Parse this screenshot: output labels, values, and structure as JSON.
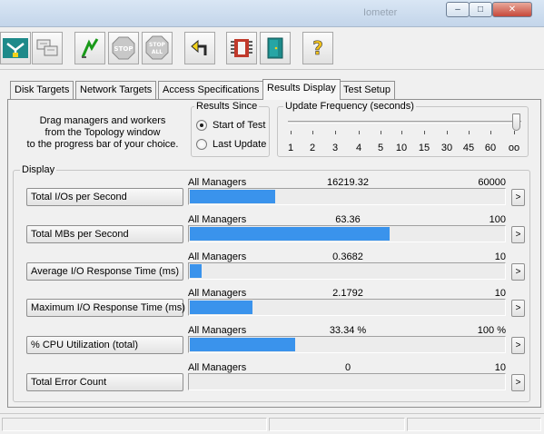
{
  "window": {
    "background_title": "Iometer"
  },
  "toolbar": {
    "buttons": [
      {
        "icon": "topology-icon"
      },
      {
        "icon": "disk-workers-icon"
      },
      {
        "icon": "start-flag-icon"
      },
      {
        "icon": "stop-icon",
        "text": "STOP"
      },
      {
        "icon": "stop-all-icon",
        "text": "STOP ALL"
      },
      {
        "icon": "reset-workers-icon"
      },
      {
        "icon": "open-config-icon"
      },
      {
        "icon": "exit-icon"
      },
      {
        "icon": "help-icon",
        "text": "?"
      }
    ]
  },
  "tabs": [
    {
      "label": "Disk Targets",
      "active": false
    },
    {
      "label": "Network Targets",
      "active": false
    },
    {
      "label": "Access Specifications",
      "active": false
    },
    {
      "label": "Results Display",
      "active": true
    },
    {
      "label": "Test Setup",
      "active": false
    }
  ],
  "drag_text": {
    "line1": "Drag managers and workers",
    "line2": "from the Topology window",
    "line3": "to the progress bar of your choice."
  },
  "results_since": {
    "label": "Results Since",
    "options": [
      {
        "label": "Start of Test",
        "checked": true
      },
      {
        "label": "Last Update",
        "checked": false
      }
    ]
  },
  "update_frequency": {
    "label": "Update Frequency (seconds)",
    "ticks": [
      "1",
      "2",
      "3",
      "4",
      "5",
      "10",
      "15",
      "30",
      "45",
      "60",
      "oo"
    ],
    "selected": "oo"
  },
  "display": {
    "label": "Display",
    "more_label": ">",
    "rows": [
      {
        "metric": "Total I/Os per Second",
        "manager": "All Managers",
        "value": "16219.32",
        "max": "60000",
        "fill": 0.27
      },
      {
        "metric": "Total MBs per Second",
        "manager": "All Managers",
        "value": "63.36",
        "max": "100",
        "fill": 0.634
      },
      {
        "metric": "Average I/O Response Time (ms)",
        "manager": "All Managers",
        "value": "0.3682",
        "max": "10",
        "fill": 0.037
      },
      {
        "metric": "Maximum I/O Response Time (ms)",
        "manager": "All Managers",
        "value": "2.1792",
        "max": "10",
        "fill": 0.2
      },
      {
        "metric": "% CPU Utilization (total)",
        "manager": "All Managers",
        "value": "33.34 %",
        "max": "100 %",
        "fill": 0.333
      },
      {
        "metric": "Total Error Count",
        "manager": "All Managers",
        "value": "0",
        "max": "10",
        "fill": 0
      }
    ]
  },
  "colors": {
    "bar_fill": "#3a93ec",
    "panel_bg": "#f0f0f0"
  }
}
